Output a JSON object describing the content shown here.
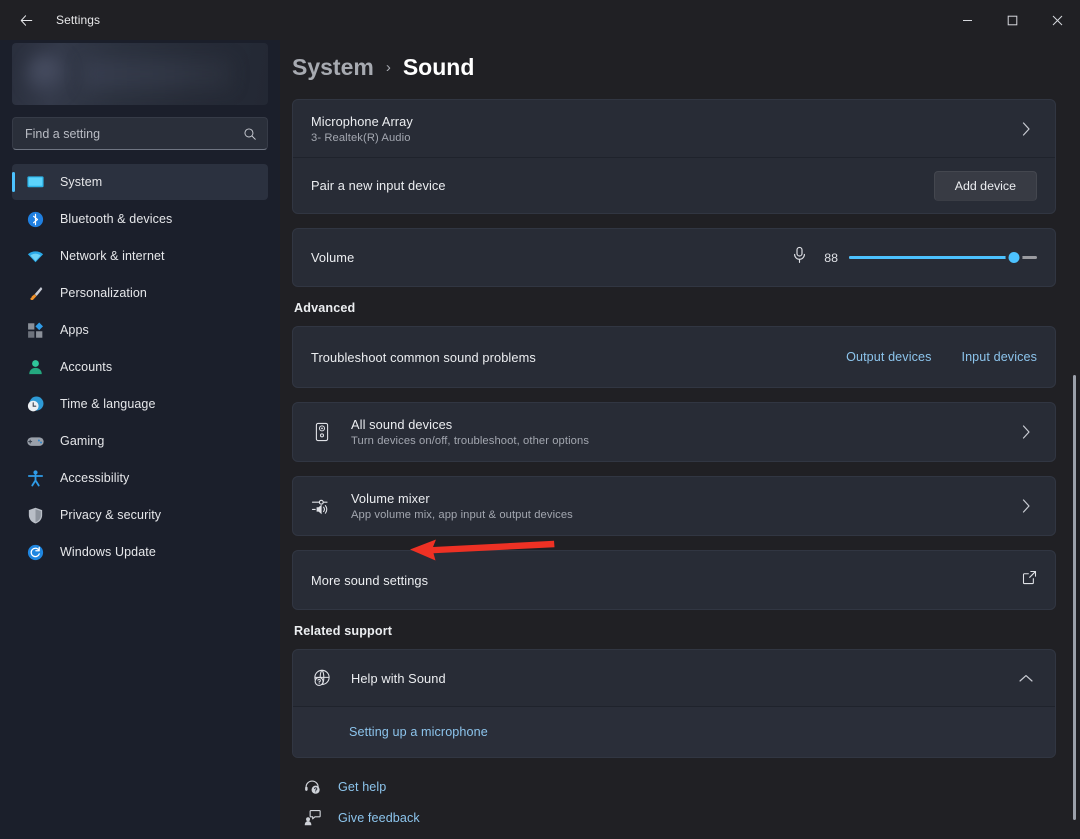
{
  "titlebar": {
    "back_label": "Back",
    "title": "Settings",
    "minimize": "Minimize",
    "maximize": "Maximize",
    "close": "Close"
  },
  "sidebar": {
    "search": {
      "value": "",
      "placeholder": "Find a setting"
    },
    "items": [
      {
        "label": "System",
        "icon": "monitor-icon",
        "selected": true
      },
      {
        "label": "Bluetooth & devices",
        "icon": "bluetooth-icon",
        "selected": false
      },
      {
        "label": "Network & internet",
        "icon": "wifi-icon",
        "selected": false
      },
      {
        "label": "Personalization",
        "icon": "paintbrush-icon",
        "selected": false
      },
      {
        "label": "Apps",
        "icon": "apps-icon",
        "selected": false
      },
      {
        "label": "Accounts",
        "icon": "person-icon",
        "selected": false
      },
      {
        "label": "Time & language",
        "icon": "clock-icon",
        "selected": false
      },
      {
        "label": "Gaming",
        "icon": "gamepad-icon",
        "selected": false
      },
      {
        "label": "Accessibility",
        "icon": "accessibility-icon",
        "selected": false
      },
      {
        "label": "Privacy & security",
        "icon": "shield-icon",
        "selected": false
      },
      {
        "label": "Windows Update",
        "icon": "update-icon",
        "selected": false
      }
    ]
  },
  "breadcrumb": {
    "parent": "System",
    "separator": "›",
    "current": "Sound"
  },
  "input_card": {
    "device": {
      "title": "Microphone Array",
      "subtitle": "3- Realtek(R) Audio"
    },
    "pair": {
      "label": "Pair a new input device",
      "button": "Add device"
    }
  },
  "volume_card": {
    "label": "Volume",
    "value": "88",
    "percent": 88,
    "icon": "microphone-icon"
  },
  "advanced": {
    "heading": "Advanced",
    "troubleshoot": {
      "label": "Troubleshoot common sound problems",
      "output_link": "Output devices",
      "input_link": "Input devices"
    },
    "all_devices": {
      "title": "All sound devices",
      "subtitle": "Turn devices on/off, troubleshoot, other options",
      "icon": "speaker-box-icon"
    },
    "volume_mixer": {
      "title": "Volume mixer",
      "subtitle": "App volume mix, app input & output devices",
      "icon": "mixer-icon"
    },
    "more_settings": {
      "title": "More sound settings",
      "icon": "external-link-icon"
    }
  },
  "related_support": {
    "heading": "Related support",
    "help": {
      "title": "Help with Sound",
      "icon": "globe-help-icon",
      "expanded": true
    },
    "link": "Setting up a microphone"
  },
  "footer": {
    "get_help": {
      "label": "Get help",
      "icon": "help-icon"
    },
    "give_feedback": {
      "label": "Give feedback",
      "icon": "feedback-icon"
    }
  },
  "annotation": {
    "type": "arrow-left",
    "color": "#ee3124",
    "points_to": "More sound settings"
  },
  "colors": {
    "accent": "#4cc2ff",
    "link": "#8cc4ec",
    "page_bg": "#202024",
    "sidebar_bg": "#1b1f2b",
    "card_bg": "#282c36",
    "annotation_red": "#ee3124"
  }
}
